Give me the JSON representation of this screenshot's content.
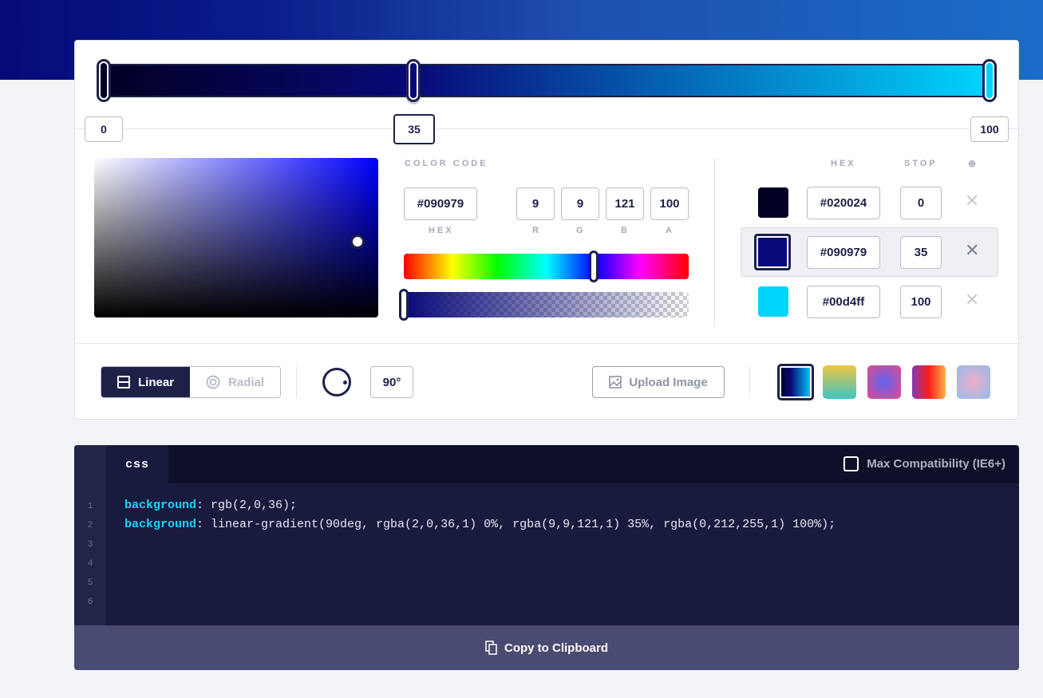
{
  "gradient": {
    "stops": [
      {
        "color": "#020024",
        "hex": "#020024",
        "stop": "0",
        "pos": 0
      },
      {
        "color": "#090979",
        "hex": "#090979",
        "stop": "35",
        "pos": 35
      },
      {
        "color": "#00d4ff",
        "hex": "#00d4ff",
        "stop": "100",
        "pos": 100
      }
    ],
    "active_stop_index": 1
  },
  "picker": {
    "color_code_label": "COLOR CODE",
    "hex_value": "#090979",
    "hex_label": "HEX",
    "r": "9",
    "g": "9",
    "b": "121",
    "a": "100",
    "r_label": "R",
    "g_label": "G",
    "b_label": "B",
    "a_label": "A",
    "hue_fraction": 0.667,
    "alpha_fraction": 0.0
  },
  "stops_table": {
    "hex_header": "HEX",
    "stop_header": "STOP",
    "add_icon": "⊕",
    "remove_icon": "✕"
  },
  "controls": {
    "linear_label": "Linear",
    "radial_label": "Radial",
    "type_selected": "linear",
    "angle": "90°",
    "upload_label": "Upload Image"
  },
  "presets": [
    {
      "name": "preset-current",
      "colors": [
        "#020024",
        "#090979",
        "#00d4ff"
      ]
    },
    {
      "name": "preset-yellow-teal",
      "colors": [
        "#eec643",
        "#3fc3c0"
      ]
    },
    {
      "name": "preset-radial-blue-pink",
      "colors": [
        "#5f64f0",
        "#e14c8c"
      ]
    },
    {
      "name": "preset-purple-orange",
      "colors": [
        "#833ab4",
        "#fd1d1d",
        "#fcb045"
      ]
    },
    {
      "name": "preset-radial-pink-blue",
      "colors": [
        "#eeaeca",
        "#94bbe9"
      ]
    }
  ],
  "code": {
    "tab": "css",
    "compat_label": "Max Compatibility (IE6+)",
    "line_numbers": [
      "1",
      "2",
      "3",
      "4",
      "5",
      "6"
    ],
    "line1_prop": "background",
    "line1_val": ": rgb(2,0,36);",
    "line2_prop": "background",
    "line2_val": ": linear-gradient(90deg, rgba(2,0,36,1) 0%, rgba(9,9,121,1) 35%, rgba(0,212,255,1) 100%);",
    "copy_label": "Copy to Clipboard"
  }
}
